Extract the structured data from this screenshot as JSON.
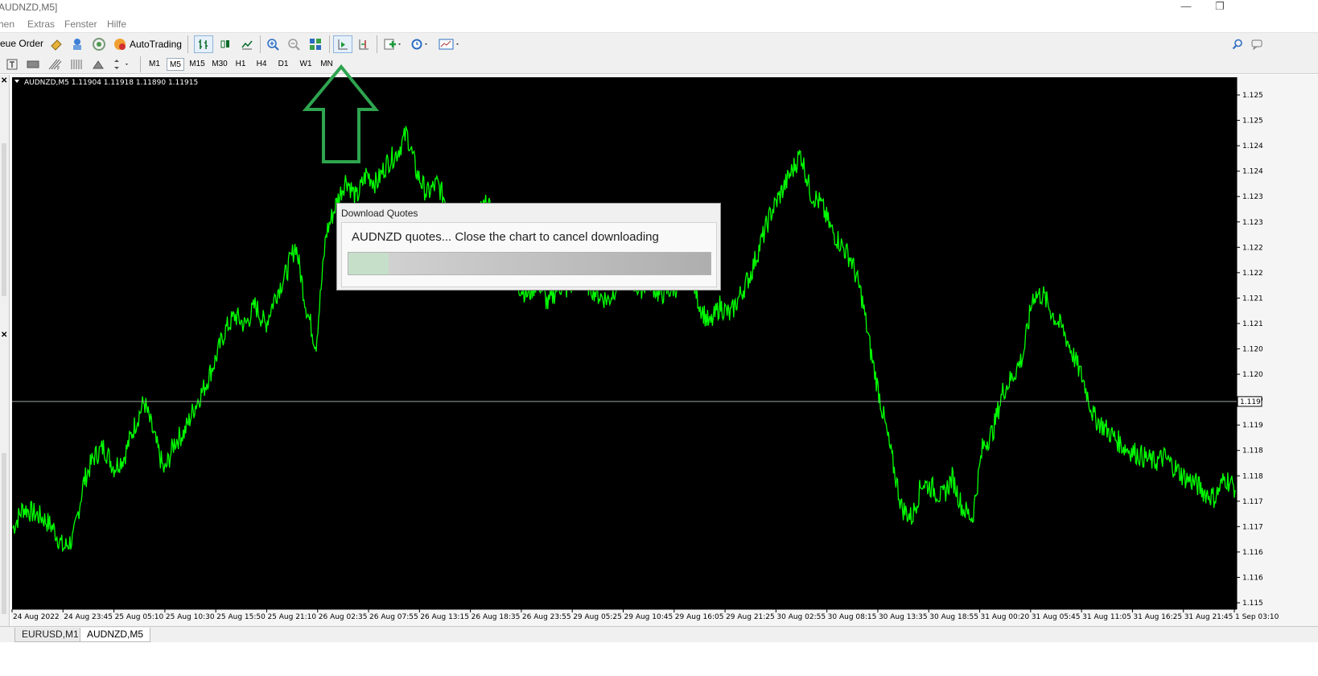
{
  "window": {
    "title": "AUDNZD,M5]",
    "controls": [
      "—",
      "❐"
    ]
  },
  "menu": [
    "hen",
    "Extras",
    "Fenster",
    "Hilfe"
  ],
  "toolbar": {
    "new_order": "eue Order",
    "autotrading": "AutoTrading"
  },
  "timeframes": [
    "M1",
    "M5",
    "M15",
    "M30",
    "H1",
    "H4",
    "D1",
    "W1",
    "MN"
  ],
  "selected_timeframe": "M5",
  "chart": {
    "header": "AUDNZD,M5  1.11904 1.11918 1.11890 1.11915",
    "current_price": "1.119"
  },
  "chart_data": {
    "type": "line",
    "symbol": "AUDNZD",
    "timeframe": "M5",
    "ohlc": {
      "open": 1.11904,
      "high": 1.11918,
      "low": 1.1189,
      "close": 1.11915
    },
    "y_tick_labels": [
      "1.125",
      "1.125",
      "1.124",
      "1.124",
      "1.123",
      "1.123",
      "1.122",
      "1.122",
      "1.121",
      "1.121",
      "1.120",
      "1.120",
      "1.119",
      "1.119",
      "1.118",
      "1.118",
      "1.117",
      "1.117",
      "1.116",
      "1.116",
      "1.115"
    ],
    "x_tick_labels": [
      "24 Aug 2022",
      "24 Aug 23:45",
      "25 Aug 05:10",
      "25 Aug 10:30",
      "25 Aug 15:50",
      "25 Aug 21:10",
      "26 Aug 02:35",
      "26 Aug 07:55",
      "26 Aug 13:15",
      "26 Aug 18:35",
      "26 Aug 23:55",
      "29 Aug 05:25",
      "29 Aug 10:45",
      "29 Aug 16:05",
      "29 Aug 21:25",
      "30 Aug 02:55",
      "30 Aug 08:15",
      "30 Aug 13:35",
      "30 Aug 18:55",
      "31 Aug 00:20",
      "31 Aug 05:45",
      "31 Aug 11:05",
      "31 Aug 16:25",
      "31 Aug 21:45",
      "1 Sep 03:10"
    ],
    "ylim": [
      1.115,
      1.1255
    ],
    "current_price_line": 1.1191,
    "series": [
      {
        "color": "#00ff00",
        "values": [
          1.1166,
          1.117,
          1.1169,
          1.1168,
          1.1166,
          1.1162,
          1.1164,
          1.1175,
          1.118,
          1.1182,
          1.1178,
          1.118,
          1.1186,
          1.1191,
          1.1184,
          1.1177,
          1.1183,
          1.1185,
          1.119,
          1.1194,
          1.1199,
          1.1205,
          1.1208,
          1.1206,
          1.121,
          1.1206,
          1.1212,
          1.1216,
          1.1222,
          1.121,
          1.1202,
          1.1224,
          1.123,
          1.1235,
          1.1231,
          1.1236,
          1.1234,
          1.1238,
          1.124,
          1.1244,
          1.1236,
          1.1232,
          1.1234,
          1.123,
          1.1228,
          1.1225,
          1.1228,
          1.123,
          1.1223,
          1.1218,
          1.1214,
          1.1212,
          1.1215,
          1.121,
          1.1214,
          1.1213,
          1.1216,
          1.1214,
          1.1212,
          1.1211,
          1.1215,
          1.1216,
          1.1213,
          1.1215,
          1.1212,
          1.1213,
          1.1214,
          1.1217,
          1.121,
          1.1206,
          1.121,
          1.1208,
          1.1212,
          1.1216,
          1.1222,
          1.1228,
          1.1232,
          1.1236,
          1.124,
          1.1232,
          1.123,
          1.1225,
          1.1222,
          1.1219,
          1.1212,
          1.12,
          1.119,
          1.118,
          1.117,
          1.1168,
          1.1175,
          1.1174,
          1.1172,
          1.1176,
          1.117,
          1.1168,
          1.1182,
          1.1185,
          1.1193,
          1.1196,
          1.12,
          1.1212,
          1.1212,
          1.1208,
          1.1205,
          1.12,
          1.1195,
          1.1188,
          1.1186,
          1.1184,
          1.1182,
          1.1181,
          1.118,
          1.1179,
          1.118,
          1.1178,
          1.1176,
          1.1175,
          1.1173,
          1.1172,
          1.1176,
          1.1174
        ]
      }
    ]
  },
  "dialog": {
    "title": "Download Quotes",
    "message": "AUDNZD quotes... Close the chart to cancel downloading",
    "progress": 0.11
  },
  "tabs": [
    "EURUSD,M1",
    "AUDNZD,M5"
  ],
  "active_tab": "AUDNZD,M5",
  "annotation": {
    "arrow_color": "#2ea44f",
    "target": "auto-scroll-button"
  }
}
